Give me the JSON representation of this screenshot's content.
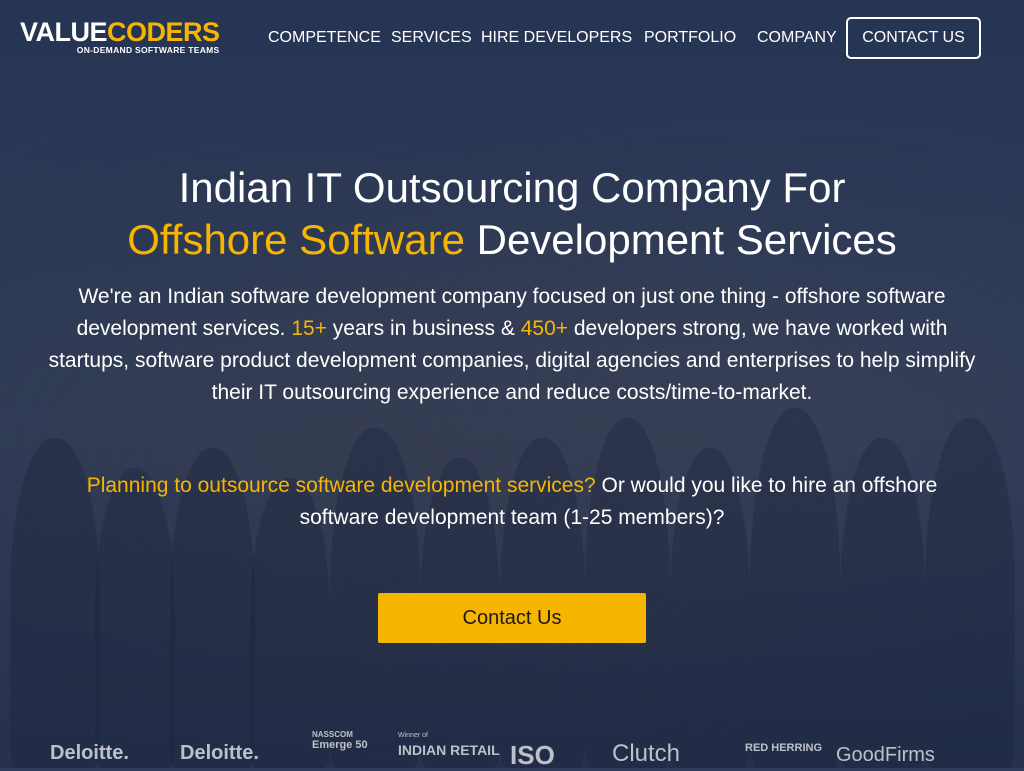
{
  "logo": {
    "part1": "VALUE",
    "part2": "CODERS",
    "tagline": "ON-DEMAND SOFTWARE TEAMS"
  },
  "nav": {
    "items": [
      {
        "label": "COMPETENCE"
      },
      {
        "label": "SERVICES"
      },
      {
        "label": "HIRE DEVELOPERS"
      },
      {
        "label": "PORTFOLIO"
      },
      {
        "label": "COMPANY"
      }
    ],
    "contact_label": "CONTACT US"
  },
  "hero": {
    "title_line1": "Indian IT Outsourcing Company For",
    "title_highlight": "Offshore Software",
    "title_rest": " Development Services",
    "intro_a": "We're an Indian software development company focused on just one thing - offshore software development services. ",
    "years": "15+",
    "intro_b": " years in business & ",
    "devs": "450+",
    "intro_c": " developers strong, we have worked with startups, software product development companies, digital agencies and enterprises to help simplify their IT outsourcing experience and reduce costs/time-to-market.",
    "question_highlight": "Planning to outsource software development services?",
    "question_rest": " Or would you like to hire an offshore software development team (1-25 members)?",
    "cta_label": "Contact Us"
  },
  "badges": [
    {
      "label": "Deloitte."
    },
    {
      "label": "Deloitte."
    },
    {
      "label": "NASSCOM",
      "sub": "Emerge 50"
    },
    {
      "label": "INDIAN RETAIL",
      "sub": "Winner of"
    },
    {
      "label": "ISO"
    },
    {
      "label": "Clutch"
    },
    {
      "label": "RED HERRING"
    },
    {
      "label": "GoodFirms"
    }
  ],
  "colors": {
    "accent": "#f7b500",
    "overlay": "#2e3c5a"
  }
}
